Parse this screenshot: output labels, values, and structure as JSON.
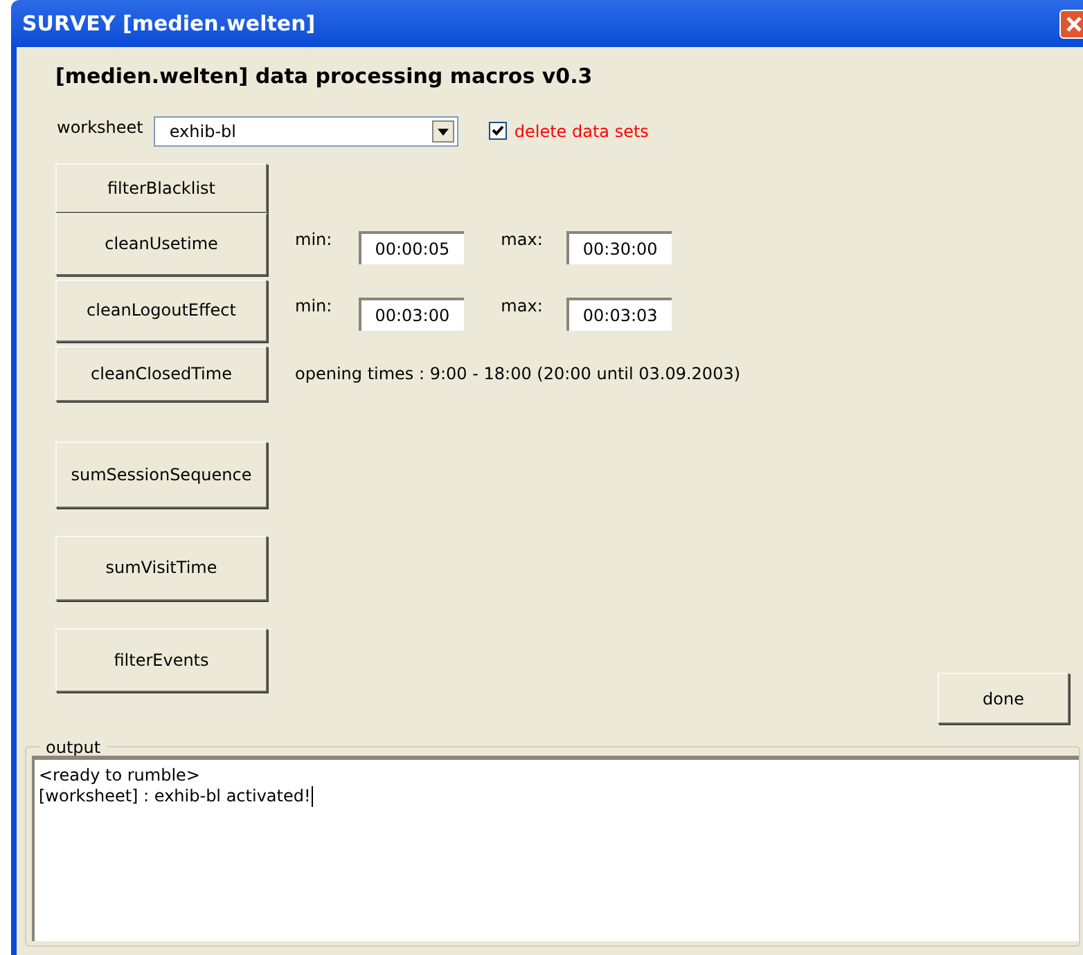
{
  "window": {
    "title": "SURVEY [medien.welten]"
  },
  "heading": "[medien.welten] data processing macros v0.3",
  "worksheet": {
    "label": "worksheet",
    "value": "exhib-bl"
  },
  "delete_option": {
    "label": "delete data sets",
    "checked": true
  },
  "macros": [
    {
      "label": "filterBlacklist",
      "kind": "plain"
    },
    {
      "label": "cleanUsetime",
      "kind": "range",
      "min_label": "min:",
      "min": "00:00:05",
      "max_label": "max:",
      "max": "00:30:00"
    },
    {
      "label": "cleanLogoutEffect",
      "kind": "range",
      "min_label": "min:",
      "min": "00:03:00",
      "max_label": "max:",
      "max": "00:03:03"
    },
    {
      "label": "cleanClosedTime",
      "kind": "note",
      "note": "opening times : 9:00 - 18:00 (20:00 until 03.09.2003)"
    },
    {
      "label": "sumSessionSequence",
      "kind": "plain"
    },
    {
      "label": "sumVisitTime",
      "kind": "plain"
    },
    {
      "label": "filterEvents",
      "kind": "plain"
    }
  ],
  "done_button": "done",
  "output": {
    "legend": "output",
    "lines": [
      "<ready to rumble>",
      "[worksheet] : exhib-bl activated!"
    ]
  }
}
